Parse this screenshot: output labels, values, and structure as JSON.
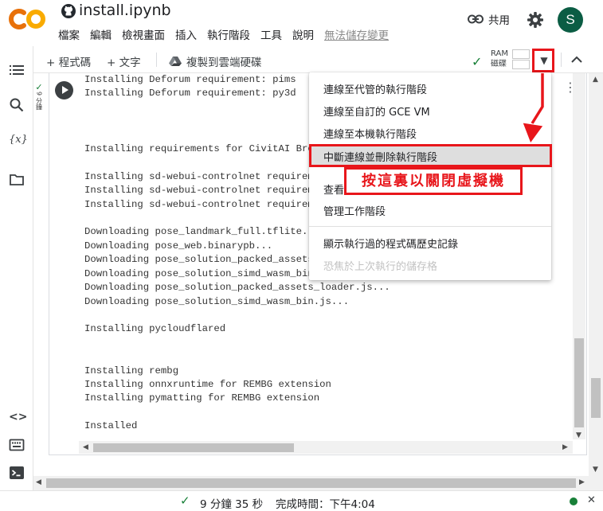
{
  "header": {
    "file_title": "install.ipynb",
    "menu": [
      "檔案",
      "編輯",
      "檢視畫面",
      "插入",
      "執行階段",
      "工具",
      "說明"
    ],
    "unsaved": "無法儲存變更",
    "share_label": "共用",
    "avatar_initial": "S"
  },
  "toolbar": {
    "add_code": "+ 程式碼",
    "add_text": "+ 文字",
    "copy_to_drive": "複製到雲端硬碟",
    "ram_label": "RAM",
    "disk_label": "磁碟"
  },
  "cell": {
    "status_check": "✓",
    "status_duration": "9 分鐘",
    "output_lines": [
      "Installing Deforum requirement: pims",
      "Installing Deforum requirement: py3d",
      "",
      "",
      "",
      "Installing requirements for CivitAI Browser",
      "",
      "Installing sd-webui-controlnet requirement",
      "Installing sd-webui-controlnet requirement",
      "Installing sd-webui-controlnet requirement",
      "",
      "Downloading pose_landmark_full.tflite...",
      "Downloading pose_web.binarypb...",
      "Downloading pose_solution_packed_assets.data...",
      "Downloading pose_solution_simd_wasm_bin.wasm...",
      "Downloading pose_solution_packed_assets_loader.js...",
      "Downloading pose_solution_simd_wasm_bin.js...",
      "",
      "Installing pycloudflared",
      "",
      "",
      "Installing rembg",
      "Installing onnxruntime for REMBG extension",
      "Installing pymatting for REMBG extension",
      "",
      "Installed"
    ]
  },
  "menu": {
    "items": [
      {
        "label": "連線至代管的執行階段",
        "enabled": true
      },
      {
        "label": "連線至自訂的 GCE VM",
        "enabled": true
      },
      {
        "label": "連線至本機執行階段",
        "enabled": true
      },
      {
        "label": "中斷連線並刪除執行階段",
        "enabled": true
      },
      {
        "label": "查看",
        "enabled": true
      },
      {
        "label": "管理工作階段",
        "enabled": true
      },
      {
        "label": "顯示執行過的程式碼歷史記錄",
        "enabled": true
      },
      {
        "label": "恐焦於上次執行的儲存格",
        "enabled": false
      }
    ]
  },
  "annotation": {
    "callout": "按這裏以關閉虛擬機"
  },
  "status": {
    "check": "✓",
    "elapsed": "9 分鐘 35 秒",
    "completed": "完成時間：下午4:04"
  },
  "colors": {
    "highlight": "#e8161b",
    "connected": "#188038",
    "avatar_bg": "#0b5d44",
    "logo_orange": "#f9ab00",
    "logo_deep": "#e8710a"
  },
  "icons": [
    "colab-logo-icon",
    "github-icon",
    "link-icon",
    "gear-icon",
    "toc-icon",
    "search-icon",
    "variables-icon",
    "folder-icon",
    "code-snippets-icon",
    "command-palette-icon",
    "terminal-icon",
    "drive-icon",
    "check-icon",
    "chevron-down-icon",
    "chevron-up-icon",
    "run-cell-icon",
    "more-vert-icon"
  ]
}
